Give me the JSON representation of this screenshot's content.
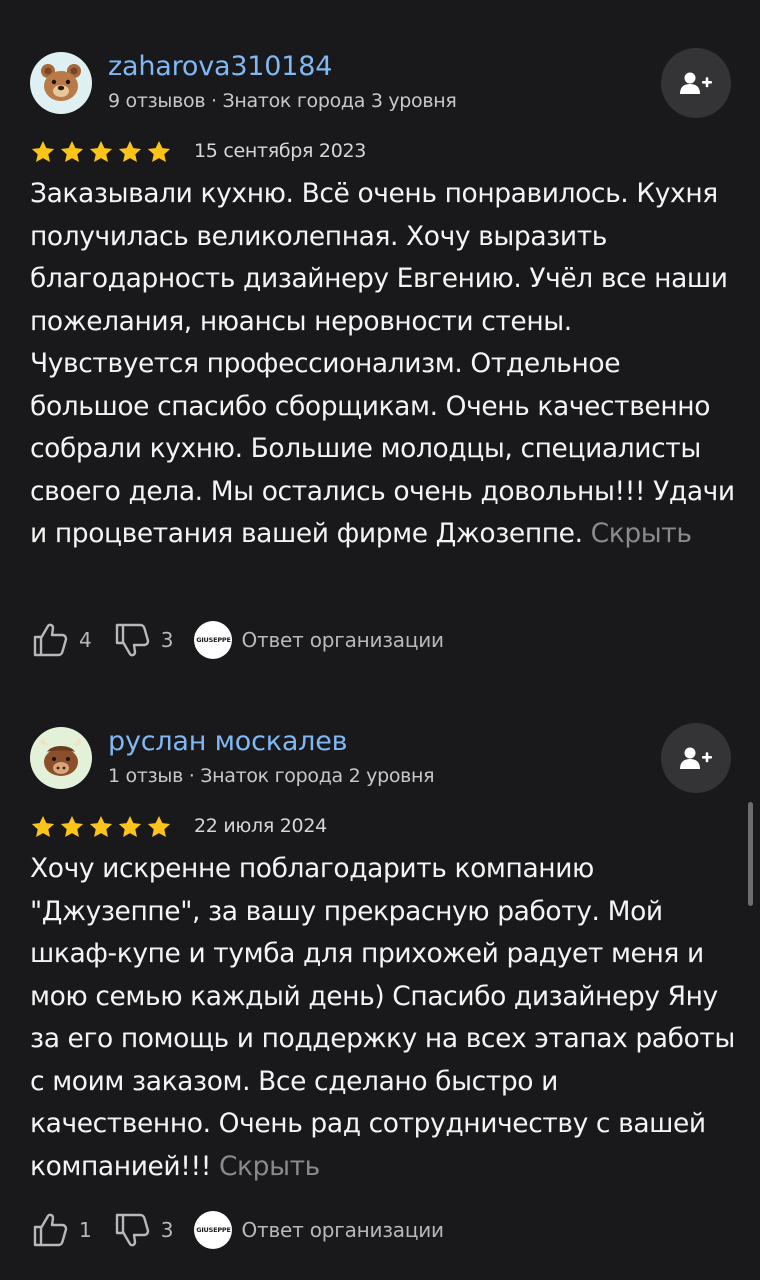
{
  "reviews": [
    {
      "author": "zaharova310184",
      "meta": "9 отзывов · Знаток города 3 уровня",
      "avatar_icon": "bear-avatar",
      "rating": 5,
      "date": "15 сентября 2023",
      "text": "Заказывали кухню. Всё очень понравилось. Кухня получилась великолепная. Хочу выразить благодарность дизайнеру Евгению. Учёл все наши пожелания, нюансы неровности стены. Чувствуется профессионализм. Отдельное большое спасибо сборщикам. Очень качественно собрали кухню. Большие молодцы, специалисты своего дела. Мы остались очень довольны!!! Удачи и процветания вашей фирме Джозеппе.",
      "hide_label": "Скрыть",
      "likes": "4",
      "dislikes": "3",
      "org_logo_text": "GIUSEPPE",
      "org_answer_label": "Ответ организации"
    },
    {
      "author": "руслан москалев",
      "meta": "1 отзыв · Знаток города 2 уровня",
      "avatar_icon": "yak-avatar",
      "rating": 5,
      "date": "22 июля 2024",
      "text": "Хочу искренне поблагодарить компанию \"Джузеппе\", за вашу прекрасную работу. Мой шкаф-купе и тумба для прихожей радует меня и мою семью каждый день) Спасибо дизайнеру Яну за его помощь и поддержку на всех этапах работы с моим заказом. Все сделано быстро и качественно. Очень рад сотрудничеству с вашей компанией!!!",
      "hide_label": "Скрыть",
      "likes": "1",
      "dislikes": "3",
      "org_logo_text": "GIUSEPPE",
      "org_answer_label": "Ответ организации"
    }
  ],
  "colors": {
    "background": "#19191b",
    "author_link": "#7fb8f4",
    "star": "#fcc419",
    "muted_link": "#8a8a8e"
  },
  "icons": [
    "bear-avatar",
    "yak-avatar",
    "subscribe-icon",
    "star-icon",
    "thumbs-up-icon",
    "thumbs-down-icon"
  ]
}
